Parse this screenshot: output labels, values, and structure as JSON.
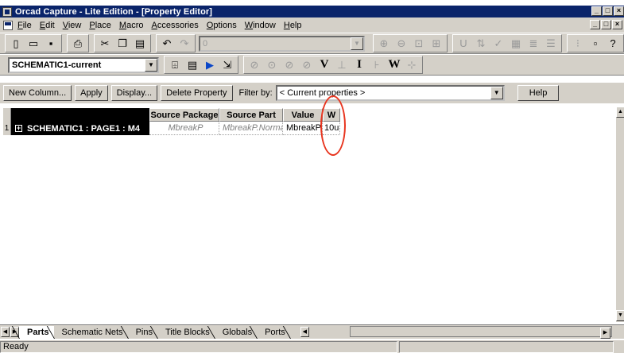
{
  "window": {
    "title": "Orcad Capture - Lite Edition - [Property Editor]",
    "buttons": [
      "_",
      "□",
      "×"
    ]
  },
  "menu": {
    "items": [
      "File",
      "Edit",
      "View",
      "Place",
      "Macro",
      "Accessories",
      "Options",
      "Window",
      "Help"
    ],
    "mdi_buttons": [
      "_",
      "□",
      "×"
    ]
  },
  "toolbar1": {
    "zoom_value": "0",
    "icons": [
      "new-icon",
      "open-icon",
      "save-icon",
      "print-icon",
      "cut-icon",
      "copy-icon",
      "paste-icon",
      "undo-icon",
      "redo-icon",
      "zoom-in-icon",
      "zoom-out-icon",
      "zoom-area-icon",
      "zoom-all-icon",
      "annotate-icon",
      "back-annotate-icon",
      "drc-icon",
      "netlist-icon",
      "bom-icon",
      "snap-icon",
      "project-manager-icon",
      "help-icon"
    ]
  },
  "toolbar2": {
    "schematic_select": "SCHEMATIC1-current",
    "probe_letters": [
      "V",
      "I",
      "W"
    ]
  },
  "actions": {
    "new_column": "New Column...",
    "apply": "Apply",
    "display": "Display...",
    "delete_property": "Delete Property",
    "filter_label": "Filter by:",
    "filter_value": "< Current properties >",
    "help": "Help"
  },
  "grid": {
    "columns": [
      "Source Package",
      "Source Part",
      "Value",
      "W"
    ],
    "rows": [
      {
        "num": "1",
        "expand": "+",
        "name": "SCHEMATIC1 : PAGE1 : M4",
        "cells": [
          "MbreakP",
          "MbreakP.Normal",
          "MbreakP",
          "10u"
        ]
      }
    ]
  },
  "tabs": [
    "Parts",
    "Schematic Nets",
    "Pins",
    "Title Blocks",
    "Globals",
    "Ports"
  ],
  "status": {
    "text": "Ready"
  },
  "colors": {
    "title_bar": "#0a246a",
    "chrome": "#d4d0c8",
    "annotation_circle": "#e8351f"
  }
}
